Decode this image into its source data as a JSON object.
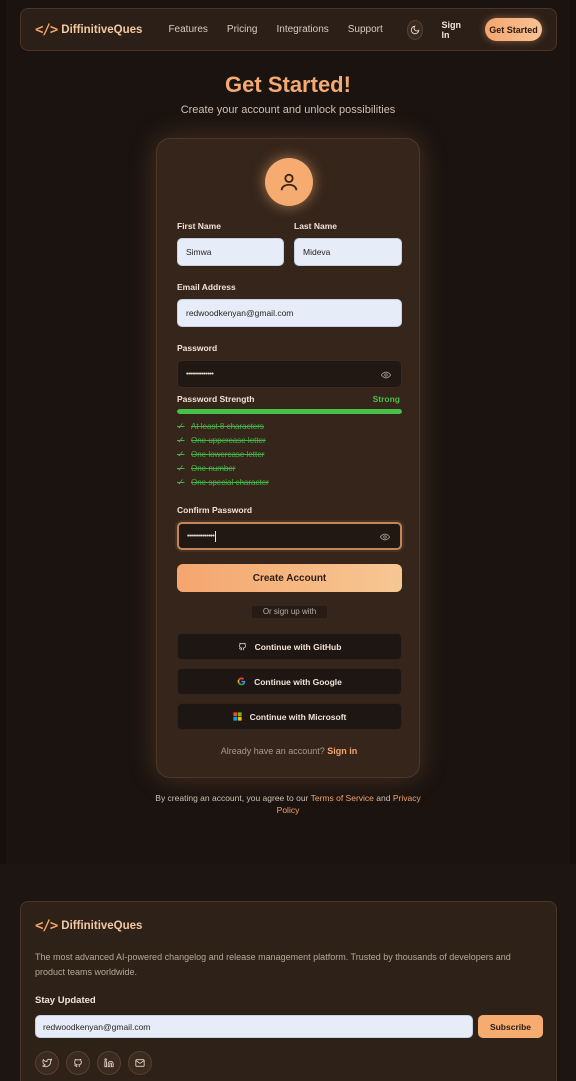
{
  "nav": {
    "brand": "DiffinitiveQues",
    "links": [
      "Features",
      "Pricing",
      "Integrations",
      "Support"
    ],
    "sign_in": "Sign In",
    "get_started": "Get Started"
  },
  "header": {
    "title": "Get Started!",
    "subtitle": "Create your account and unlock possibilities"
  },
  "form": {
    "first_name_label": "First Name",
    "first_name_value": "Simwa",
    "last_name_label": "Last Name",
    "last_name_value": "Mideva",
    "email_label": "Email Address",
    "email_value": "redwoodkenyan@gmail.com",
    "password_label": "Password",
    "password_value": "••••••••••••••",
    "strength_label": "Password Strength",
    "strength_value": "Strong",
    "strength_fraction": 1.0,
    "requirements": [
      "At least 8 characters",
      "One uppercase letter",
      "One lowercase letter",
      "One number",
      "One special character"
    ],
    "confirm_label": "Confirm Password",
    "confirm_value": "••••••••••••••",
    "create_button": "Create Account",
    "or_text": "Or sign up with",
    "github_button": "Continue with GitHub",
    "google_button": "Continue with Google",
    "microsoft_button": "Continue with Microsoft",
    "already_text": "Already have an account?",
    "sign_in_link": "Sign in"
  },
  "terms": {
    "prefix": "By creating an account, you agree to our",
    "terms_link": "Terms of Service",
    "and": "and",
    "privacy_link": "Privacy Policy"
  },
  "footer": {
    "brand": "DiffinitiveQues",
    "description": "The most advanced AI-powered changelog and release management platform. Trusted by thousands of developers and product teams worldwide.",
    "stay_updated": "Stay Updated",
    "email_value": "redwoodkenyan@gmail.com",
    "subscribe": "Subscribe",
    "social_icons": [
      "twitter-icon",
      "github-icon",
      "linkedin-icon",
      "mail-icon"
    ]
  },
  "colors": {
    "accent": "#f5a56e",
    "success": "#46c046",
    "background": "#1a1310"
  }
}
